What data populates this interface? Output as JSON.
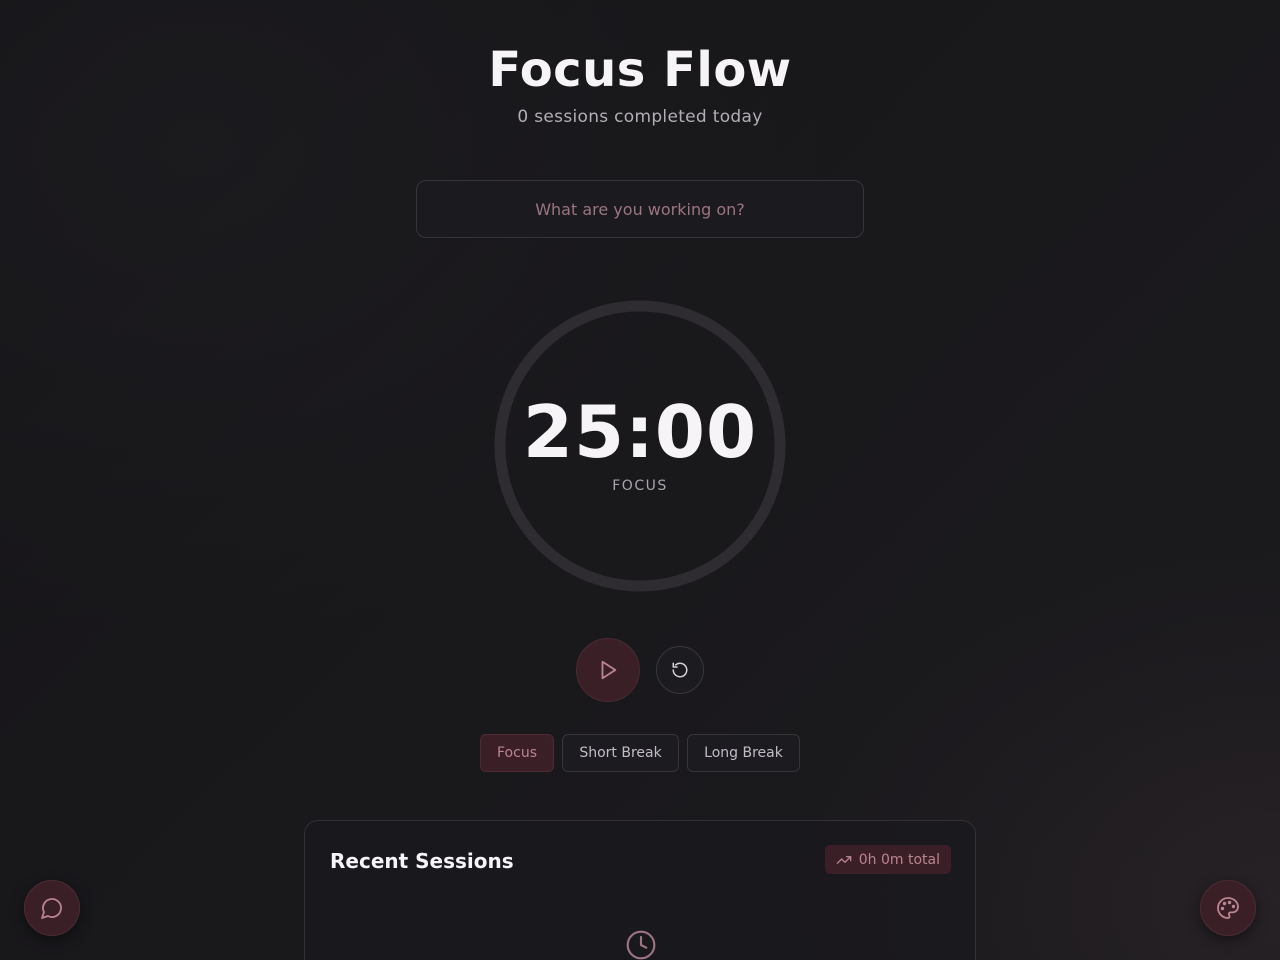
{
  "header": {
    "title": "Focus Flow",
    "subtitle": "0 sessions completed today"
  },
  "task": {
    "value": "",
    "placeholder": "What are you working on?"
  },
  "timer": {
    "time": "25:00",
    "mode": "FOCUS",
    "progress": 0
  },
  "controls": {
    "play_icon": "play-icon",
    "reset_icon": "reset-icon"
  },
  "modes": [
    {
      "label": "Focus",
      "active": true
    },
    {
      "label": "Short Break",
      "active": false
    },
    {
      "label": "Long Break",
      "active": false
    }
  ],
  "sessions": {
    "title": "Recent Sessions",
    "total": "0h 0m total",
    "empty_icon": "clock-icon"
  },
  "fabs": {
    "left_icon": "chat-icon",
    "right_icon": "palette-icon"
  },
  "colors": {
    "accent": "#b98592",
    "accent_bg": "#3a1f26",
    "background": "#161518",
    "ring": "#2e2c31"
  }
}
